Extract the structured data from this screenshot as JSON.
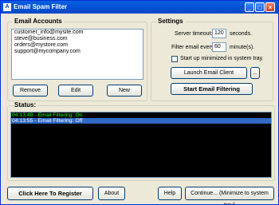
{
  "window": {
    "title": "Email Spam Filter",
    "icon_text": "A",
    "minimize_glyph": "_",
    "maximize_glyph": "□",
    "close_glyph": "×"
  },
  "email_accounts": {
    "label": "Email Accounts",
    "items": [
      "customer_info@mysite.com",
      "steve@business.com",
      "orders@mystore.com",
      "support@mycompany.com"
    ],
    "remove_label": "Remove",
    "edit_label": "Edit",
    "new_label": "New"
  },
  "settings": {
    "label": "Settings",
    "server_timeout_label": "Server timeout:",
    "server_timeout_value": "120",
    "server_timeout_unit": "seconds.",
    "filter_every_label": "Filter email every:",
    "filter_every_value": "60",
    "filter_every_unit": "minute(s).",
    "startup_label": "Start up minimized in system tray.",
    "startup_checked": false,
    "launch_label": "Launch Email Client",
    "browse_label": "...",
    "start_label": "Start Email Filtering"
  },
  "status": {
    "label": "Status:",
    "log": [
      {
        "text": "04:13:48 - Email Filtering: On",
        "color": "#00ff00",
        "selected": false
      },
      {
        "text": "04:13:55 - Email Filtering: Off",
        "color": "#ffffff",
        "selected": true
      }
    ]
  },
  "footer": {
    "register_label": "Click Here To Register",
    "about_label": "About",
    "help_label": "Help",
    "continue_label": "Continue... (Minimize to system tray)"
  }
}
